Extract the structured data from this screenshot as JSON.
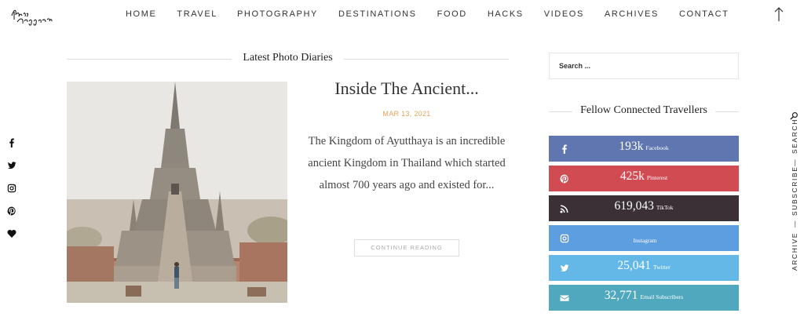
{
  "header": {
    "logo_text": "Hand Luggage Only",
    "nav": [
      "HOME",
      "TRAVEL",
      "PHOTOGRAPHY",
      "DESTINATIONS",
      "FOOD",
      "HACKS",
      "VIDEOS",
      "ARCHIVES",
      "CONTACT"
    ],
    "back_to_top_icon": "arrow-up-icon"
  },
  "social_left": [
    {
      "icon": "facebook-icon"
    },
    {
      "icon": "twitter-icon"
    },
    {
      "icon": "instagram-icon"
    },
    {
      "icon": "pinterest-icon"
    },
    {
      "icon": "heart-icon"
    }
  ],
  "vertical_menu": {
    "search": "SEARCH",
    "subscribe": "SUBSCRIBE",
    "archive": "ARCHIVE",
    "sep": "—"
  },
  "main": {
    "section_title": "Latest Photo Diaries",
    "post": {
      "title": "Inside The Ancient...",
      "date": "MAR 13, 2021",
      "excerpt": "The Kingdom of Ayutthaya is an incredible ancient Kingdom in Thailand which started almost 700 years ago and existed for...",
      "button": "CONTINUE READING"
    }
  },
  "sidebar": {
    "search_placeholder": "Search ...",
    "follow_title": "Fellow Connected Travellers",
    "follow": [
      {
        "icon": "facebook-icon",
        "count": "193k",
        "network": "Facebook",
        "color": "#5f76b0"
      },
      {
        "icon": "pinterest-icon",
        "count": "425k",
        "network": "Pinterest",
        "color": "#d14b53"
      },
      {
        "icon": "rss-icon",
        "count": "619,043",
        "network": "TikTok",
        "color": "#3a3035"
      },
      {
        "icon": "instagram-icon",
        "count": "",
        "network": "Instagram",
        "color": "#5d9ee0"
      },
      {
        "icon": "twitter-icon",
        "count": "25,041",
        "network": "Twitter",
        "color": "#63b8e8"
      },
      {
        "icon": "email-icon",
        "count": "32,771",
        "network": "Email Subscribers",
        "color": "#50a8bf"
      }
    ]
  }
}
